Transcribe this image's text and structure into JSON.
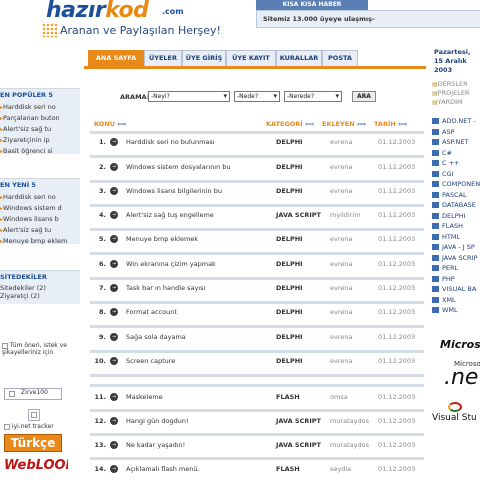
{
  "header": {
    "brand_a": "hazır",
    "brand_b": "kod",
    "brand_tld": ".com",
    "tagline": "Aranan ve Paylaşılan Herşey!",
    "news_title": "KISA KISA HABER",
    "news_text": "Sitemiz 13.000 üyeye ulaşmış-"
  },
  "tabs": [
    "ANA SAYFA",
    "ÜYELER",
    "ÜYE GİRİŞ",
    "ÜYE KAYIT",
    "KURALLAR",
    "POSTA"
  ],
  "date": {
    "line1": "Pazartesi,",
    "line2": "15 Aralık 2003"
  },
  "left": {
    "populer_title": "EN POPÜLER 5",
    "populer": [
      "Harddisk seri no",
      "Parçalanan buton",
      "Alert'siz sağ tu",
      "Ziyaretçinin ip",
      "Basit öğrenci si"
    ],
    "yeni_title": "EN YENİ 5",
    "yeni": [
      "Harddisk seri no",
      "Windows sistem d",
      "Windows lisans b",
      "Alert'siz sağ tu",
      "Menuye bmp eklem"
    ],
    "site_title": "SİTEDEKİLER",
    "site_lines": [
      "Sitedekiler (2)",
      "Ziyaretçi (2)"
    ],
    "banner1": "Tüm öneri, istek ve şikayelleriniz için",
    "banner2": "Zirve100",
    "banner3": "iyi.net tracker",
    "banner4": "Türkçe",
    "banner5": "WebLOOK"
  },
  "search": {
    "label": "ARAMA:",
    "input": "-Neyi?",
    "cat": "-Nede?",
    "where": "-Nerede?",
    "button": "ARA"
  },
  "columns": {
    "konu": "KONU",
    "kategori": "KATEGORİ",
    "ekleyen": "EKLEYEN",
    "tarih": "TARİH",
    "arrows": "⇦⇨"
  },
  "rows": [
    {
      "n": "1.",
      "t": "Harddisk seri no bulunması",
      "c": "DELPHI",
      "a": "evrena",
      "d": "01.12.2003"
    },
    {
      "n": "2.",
      "t": "Windows sistem dosyalarının bu",
      "c": "DELPHI",
      "a": "evrena",
      "d": "01.12.2003"
    },
    {
      "n": "3.",
      "t": "Windows lisans bilgilerinin bu",
      "c": "DELPHI",
      "a": "evrena",
      "d": "01.12.2003"
    },
    {
      "n": "4.",
      "t": "Alert'siz sağ tuş engelleme",
      "c": "JAVA SCRIPT",
      "a": "myildirim",
      "d": "01.12.2003"
    },
    {
      "n": "5.",
      "t": "Menuye bmp eklemek",
      "c": "DELPHI",
      "a": "evrena",
      "d": "01.12.2003"
    },
    {
      "n": "6.",
      "t": "Win ekranına çizim yapmak",
      "c": "DELPHI",
      "a": "evrena",
      "d": "01.12.2003"
    },
    {
      "n": "7.",
      "t": "Task bar ın handle sayısı",
      "c": "DELPHI",
      "a": "evrena",
      "d": "01.12.2003"
    },
    {
      "n": "8.",
      "t": "Format account",
      "c": "DELPHI",
      "a": "evrena",
      "d": "01.12.2003"
    },
    {
      "n": "9.",
      "t": "Sağa sola dayama",
      "c": "DELPHI",
      "a": "evrena",
      "d": "01.12.2003"
    },
    {
      "n": "10.",
      "t": "Screen capture",
      "c": "DELPHI",
      "a": "evrena",
      "d": "01.12.2003"
    },
    {
      "n": "11.",
      "t": "Maskeleme",
      "c": "FLASH",
      "a": "omsa",
      "d": "01.12.2003"
    },
    {
      "n": "12.",
      "t": "Hangi gün dogdun!",
      "c": "JAVA SCRIPT",
      "a": "murataydos",
      "d": "01.12.2003"
    },
    {
      "n": "13.",
      "t": "Ne kadar yaşadın!",
      "c": "JAVA SCRIPT",
      "a": "murataydos",
      "d": "01.12.2003"
    },
    {
      "n": "14.",
      "t": "Açıklamalı flash menü.",
      "c": "FLASH",
      "a": "seydia",
      "d": "01.12.2003"
    }
  ],
  "right": {
    "top": [
      "DERSLER",
      "PROJELER",
      "YARDIM"
    ],
    "langs": [
      "ADO.NET - ",
      "ASP",
      "ASP.NET",
      "C#",
      "C ++",
      "CGI",
      "COMPONEN",
      "PASCAL",
      "DATABASE",
      "DELPHI",
      "FLASH",
      "HTML",
      "JAVA - J SP",
      "JAVA SCRIP",
      "PERL",
      "PHP",
      "VISUAL BA",
      "XML",
      "WML"
    ],
    "ms": "Microsoft",
    "msnet_a": "Microsof",
    "msnet_b": ".ne",
    "vs": "Visual Stu"
  },
  "colors": {
    "accent": "#e8891a",
    "brand": "#1c4f9c",
    "panel": "#e8eef6"
  }
}
